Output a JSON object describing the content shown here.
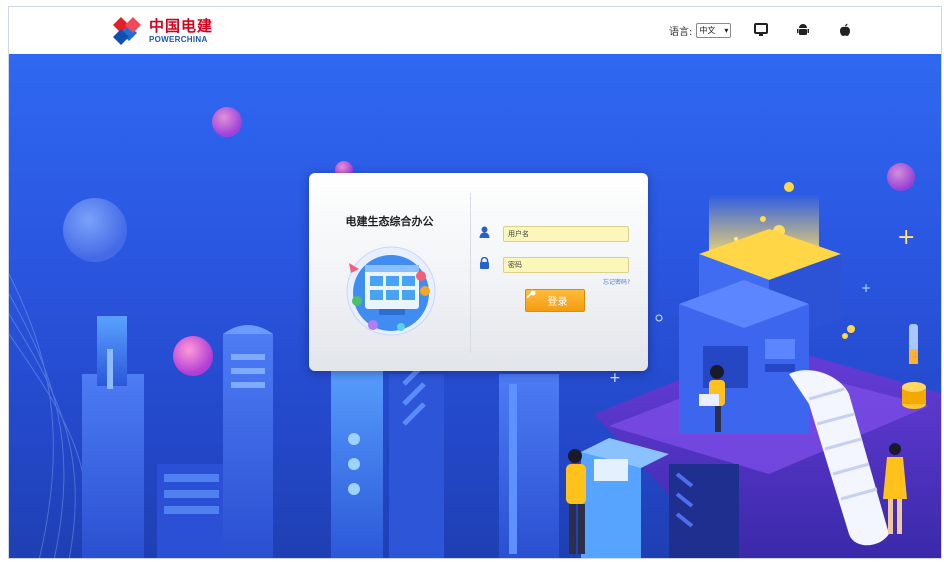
{
  "header": {
    "logo": {
      "cn": "中国电建",
      "en": "POWERCHINA"
    },
    "language_label": "语言:",
    "language_value": "中文",
    "icons": [
      "monitor-icon",
      "android-icon",
      "apple-icon"
    ]
  },
  "login": {
    "title": "电建生态综合办公",
    "username_placeholder": "用户名",
    "password_placeholder": "密码",
    "forgot_link": "忘记密码?",
    "login_button": "登录"
  },
  "colors": {
    "brand_red": "#d5001c",
    "brand_blue": "#1b57b3",
    "background_blue": "#2a56e0",
    "button_orange": "#f59b12",
    "field_fill": "#fbf6b9"
  }
}
